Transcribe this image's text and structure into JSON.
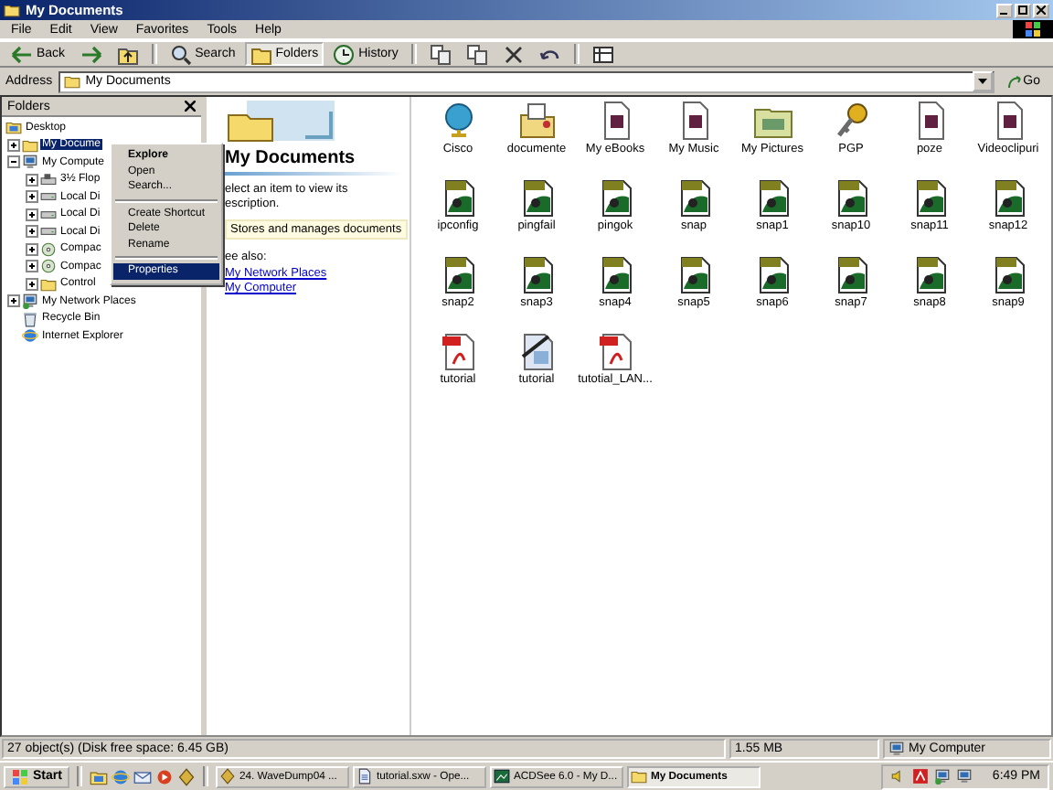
{
  "window": {
    "title": "My Documents"
  },
  "menu": [
    "File",
    "Edit",
    "View",
    "Favorites",
    "Tools",
    "Help"
  ],
  "toolbar": [
    {
      "kind": "back",
      "label": "Back",
      "selected": false
    },
    {
      "kind": "forward",
      "selected": false
    },
    {
      "kind": "up",
      "selected": false
    },
    {
      "kind": "search",
      "label": "Search",
      "selected": false
    },
    {
      "kind": "folders",
      "label": "Folders",
      "selected": true
    },
    {
      "kind": "history",
      "label": "History",
      "selected": false
    },
    {
      "kind": "move",
      "selected": false
    },
    {
      "kind": "copy",
      "selected": false
    },
    {
      "kind": "delete",
      "selected": false
    },
    {
      "kind": "undo",
      "selected": false
    },
    {
      "kind": "views",
      "selected": false
    }
  ],
  "address": {
    "label": "Address",
    "value": "My Documents",
    "go": "Go"
  },
  "folders_pane": {
    "title": "Folders",
    "tree": [
      {
        "label": "Desktop",
        "kind": "desktop",
        "selected": false,
        "children": [
          {
            "label": "My Docume",
            "kind": "folder",
            "expanded": false,
            "selected": true
          },
          {
            "label": "My Compute",
            "kind": "computer",
            "expanded": true,
            "selected": false,
            "children": [
              {
                "label": "3½ Flop",
                "kind": "floppy",
                "expanded": false,
                "selected": false
              },
              {
                "label": "Local Di",
                "kind": "drive",
                "expanded": false,
                "selected": false
              },
              {
                "label": "Local Di",
                "kind": "drive",
                "expanded": false,
                "selected": false
              },
              {
                "label": "Local Di",
                "kind": "drive",
                "expanded": false,
                "selected": false
              },
              {
                "label": "Compac",
                "kind": "cd",
                "expanded": false,
                "selected": false
              },
              {
                "label": "Compac",
                "kind": "cd",
                "expanded": false,
                "selected": false
              },
              {
                "label": "Control",
                "kind": "folder",
                "expanded": false,
                "selected": false
              }
            ]
          },
          {
            "label": "My Network Places",
            "kind": "network",
            "expanded": false,
            "selected": false
          },
          {
            "label": "Recycle Bin",
            "kind": "recycle",
            "selected": false
          },
          {
            "label": "Internet Explorer",
            "kind": "ie",
            "selected": false
          }
        ]
      }
    ]
  },
  "context_menu": [
    {
      "kind": "item",
      "label": "Explore",
      "default": true,
      "selected": false
    },
    {
      "kind": "item",
      "label": "Open",
      "default": false,
      "selected": false
    },
    {
      "kind": "item",
      "label": "Search...",
      "default": false,
      "selected": false
    },
    {
      "kind": "separator"
    },
    {
      "kind": "item",
      "label": "Create Shortcut",
      "default": false,
      "selected": false
    },
    {
      "kind": "item",
      "label": "Delete",
      "default": false,
      "selected": false
    },
    {
      "kind": "item",
      "label": "Rename",
      "default": false,
      "selected": false
    },
    {
      "kind": "separator"
    },
    {
      "kind": "item",
      "label": "Properties",
      "default": false,
      "selected": true
    }
  ],
  "web_view": {
    "title": "My Documents",
    "hint_lines": [
      "elect an item to view its",
      "escription."
    ],
    "info": "Stores and manages documents",
    "see_also": "ee also:",
    "links": [
      "My Network Places",
      "My Computer"
    ]
  },
  "files": [
    {
      "name": "Cisco",
      "kind": "globe"
    },
    {
      "name": "documente",
      "kind": "shared"
    },
    {
      "name": "My eBooks",
      "kind": "special"
    },
    {
      "name": "My Music",
      "kind": "special"
    },
    {
      "name": "My Pictures",
      "kind": "pictures"
    },
    {
      "name": "PGP",
      "kind": "keys"
    },
    {
      "name": "poze",
      "kind": "special"
    },
    {
      "name": "Videoclipuri",
      "kind": "special"
    },
    {
      "name": "ipconfig",
      "kind": "png"
    },
    {
      "name": "pingfail",
      "kind": "png"
    },
    {
      "name": "pingok",
      "kind": "png"
    },
    {
      "name": "snap",
      "kind": "png"
    },
    {
      "name": "snap1",
      "kind": "png"
    },
    {
      "name": "snap10",
      "kind": "png"
    },
    {
      "name": "snap11",
      "kind": "png"
    },
    {
      "name": "snap12",
      "kind": "png"
    },
    {
      "name": "snap2",
      "kind": "png"
    },
    {
      "name": "snap3",
      "kind": "png"
    },
    {
      "name": "snap4",
      "kind": "png"
    },
    {
      "name": "snap5",
      "kind": "png"
    },
    {
      "name": "snap6",
      "kind": "png"
    },
    {
      "name": "snap7",
      "kind": "png"
    },
    {
      "name": "snap8",
      "kind": "png"
    },
    {
      "name": "snap9",
      "kind": "png"
    },
    {
      "name": "tutorial",
      "kind": "pdf"
    },
    {
      "name": "tutorial",
      "kind": "writer"
    },
    {
      "name": "tutotial_LAN...",
      "kind": "pdf"
    }
  ],
  "status_bar": {
    "objects": "27 object(s) (Disk free space: 6.45 GB)",
    "size": "1.55 MB",
    "zone": "My Computer"
  },
  "taskbar": {
    "start": "Start",
    "quick_launch": [
      {
        "kind": "desktop"
      },
      {
        "kind": "ie"
      },
      {
        "kind": "outlook"
      },
      {
        "kind": "media"
      },
      {
        "kind": "winamp"
      }
    ],
    "tasks": [
      {
        "label": "24. WaveDump04 ...",
        "kind": "winamp",
        "selected": false
      },
      {
        "label": "tutorial.sxw - Ope...",
        "kind": "writer",
        "selected": false
      },
      {
        "label": "ACDSee 6.0 - My D...",
        "kind": "acdsee",
        "selected": false
      },
      {
        "label": "My Documents",
        "kind": "folder",
        "selected": true
      }
    ],
    "tray": [
      {
        "kind": "volume"
      },
      {
        "kind": "acrobat"
      },
      {
        "kind": "network"
      },
      {
        "kind": "monitor"
      }
    ],
    "clock": "6:49 PM"
  }
}
